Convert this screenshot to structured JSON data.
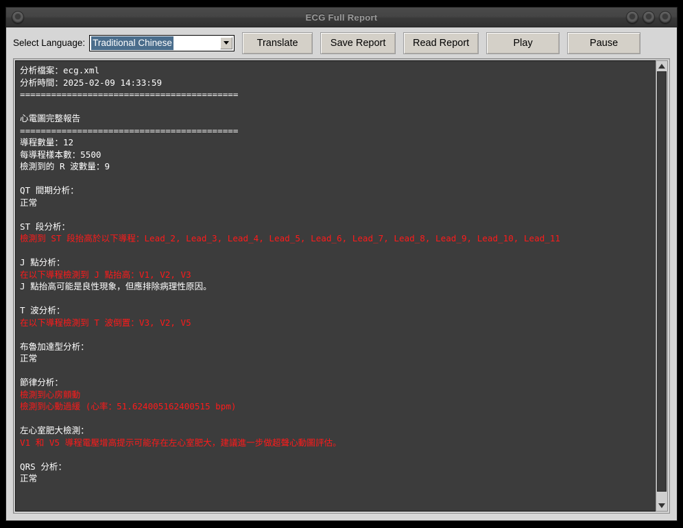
{
  "window": {
    "title": "ECG Full Report",
    "titlebar_buttons": {
      "left": "menu-circle-button",
      "right": [
        "minimize-circle-button",
        "maximize-circle-button",
        "close-circle-button"
      ]
    }
  },
  "toolbar": {
    "language_label": "Select Language:",
    "language_selected": "Traditional Chinese",
    "language_options": [
      "Traditional Chinese"
    ],
    "translate_label": "Translate",
    "save_report_label": "Save Report",
    "read_report_label": "Read Report",
    "play_label": "Play",
    "pause_label": "Pause"
  },
  "report": {
    "lines": [
      {
        "text": "分析檔案：ecg.xml",
        "color": "white"
      },
      {
        "text": "分析時間：2025-02-09 14:33:59",
        "color": "white"
      },
      {
        "text": "==========================================",
        "color": "white"
      },
      {
        "text": "",
        "color": "white"
      },
      {
        "text": "心電圖完整報告",
        "color": "white"
      },
      {
        "text": "==========================================",
        "color": "white"
      },
      {
        "text": "導程數量：12",
        "color": "white"
      },
      {
        "text": "每導程樣本數：5500",
        "color": "white"
      },
      {
        "text": "檢測到的 R 波數量：9",
        "color": "white"
      },
      {
        "text": "",
        "color": "white"
      },
      {
        "text": "QT 間期分析：",
        "color": "white"
      },
      {
        "text": "正常",
        "color": "white"
      },
      {
        "text": "",
        "color": "white"
      },
      {
        "text": "ST 段分析：",
        "color": "white"
      },
      {
        "text": "檢測到 ST 段抬高於以下導程：Lead_2, Lead_3, Lead_4, Lead_5, Lead_6, Lead_7, Lead_8, Lead_9, Lead_10, Lead_11",
        "color": "red"
      },
      {
        "text": "",
        "color": "white"
      },
      {
        "text": "J 點分析：",
        "color": "white"
      },
      {
        "text": "在以下導程檢測到 J 點抬高：V1, V2, V3",
        "color": "red"
      },
      {
        "text": "J 點抬高可能是良性現象，但應排除病理性原因。",
        "color": "white"
      },
      {
        "text": "",
        "color": "white"
      },
      {
        "text": "T 波分析：",
        "color": "white"
      },
      {
        "text": "在以下導程檢測到 T 波倒置：V3, V2, V5",
        "color": "red"
      },
      {
        "text": "",
        "color": "white"
      },
      {
        "text": "布魯加達型分析：",
        "color": "white"
      },
      {
        "text": "正常",
        "color": "white"
      },
      {
        "text": "",
        "color": "white"
      },
      {
        "text": "節律分析：",
        "color": "white"
      },
      {
        "text": "檢測到心房顫動",
        "color": "red"
      },
      {
        "text": "檢測到心動過緩 (心率：51.624005162400515 bpm)",
        "color": "red"
      },
      {
        "text": "",
        "color": "white"
      },
      {
        "text": "左心室肥大檢測：",
        "color": "white"
      },
      {
        "text": "V1 和 V5 導程電壓增高提示可能存在左心室肥大，建議進一步做超聲心動圖評估。",
        "color": "red"
      },
      {
        "text": "",
        "color": "white"
      },
      {
        "text": "QRS 分析：",
        "color": "white"
      },
      {
        "text": "正常",
        "color": "white"
      }
    ]
  },
  "scrollbar": {
    "up_arrow": "scroll-up-arrow",
    "down_arrow": "scroll-down-arrow",
    "thumb": "scroll-thumb"
  },
  "colors": {
    "window_background": "#d6d6d6",
    "titlebar": "#3f3f3f",
    "title_text": "#9a9a9a",
    "text_area_background": "#3c3c3c",
    "text_normal": "#ffffff",
    "text_alert": "#ff1a1a",
    "selection_highlight": "#4a6d8c",
    "button_face": "#d4d0c8"
  }
}
